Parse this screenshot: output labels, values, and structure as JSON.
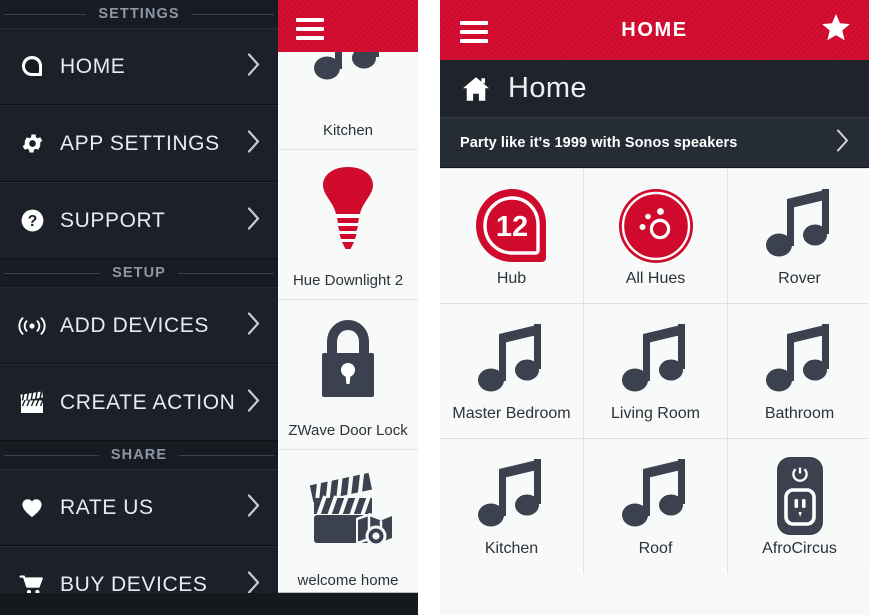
{
  "colors": {
    "brand_red": "#CF0A2C",
    "sidebar_bg": "#181B21",
    "nav_row_bg": "#1C2028",
    "dark_bar": "#1E232C",
    "promo_bg": "#262C35",
    "tile_bg": "#F8F9F9",
    "icon_dark": "#3B414E",
    "section_label": "#8D97A8"
  },
  "left_screen": {
    "sidebar": {
      "sections": [
        {
          "label": "SETTINGS",
          "items": [
            {
              "label": "HOME",
              "icon": "home-rounded-icon",
              "chevron": "›"
            },
            {
              "label": "APP SETTINGS",
              "icon": "gear-icon",
              "chevron": "›"
            },
            {
              "label": "SUPPORT",
              "icon": "question-circle-icon",
              "chevron": "›"
            }
          ]
        },
        {
          "label": "SETUP",
          "items": [
            {
              "label": "ADD DEVICES",
              "icon": "broadcast-icon",
              "chevron": "›"
            },
            {
              "label": "CREATE ACTION",
              "icon": "clapperboard-icon",
              "chevron": "›"
            }
          ]
        },
        {
          "label": "SHARE",
          "items": [
            {
              "label": "RATE US",
              "icon": "heart-icon",
              "chevron": "›"
            },
            {
              "label": "BUY DEVICES",
              "icon": "shopping-cart-icon",
              "chevron": "›"
            }
          ]
        }
      ]
    },
    "device_strip": {
      "menu_icon": "hamburger-menu-icon",
      "cells": [
        {
          "label": "Kitchen",
          "icon": "music-note-icon",
          "icon_color": "#3B414E"
        },
        {
          "label": "Hue Downlight 2",
          "icon": "light-bulb-icon",
          "icon_color": "#CF0A2C"
        },
        {
          "label": "ZWave Door Lock",
          "icon": "padlock-icon",
          "icon_color": "#3B414E"
        },
        {
          "label": "welcome home",
          "icon": "clapperboard-map-icon",
          "icon_color": "#3B414E"
        }
      ]
    }
  },
  "right_screen": {
    "app_bar": {
      "menu_icon": "hamburger-menu-icon",
      "title": "HOME",
      "favorite_icon": "star-icon"
    },
    "location_bar": {
      "icon": "house-icon",
      "name": "Home"
    },
    "promo": {
      "text": "Party like it's 1999 with Sonos speakers",
      "chevron": "›"
    },
    "tiles": [
      {
        "label": "Hub",
        "icon": "smartthings-hub-icon",
        "badge": "12",
        "icon_color": "#CF0A2C"
      },
      {
        "label": "All Hues",
        "icon": "hue-group-icon",
        "icon_color": "#CF0A2C"
      },
      {
        "label": "Rover",
        "icon": "music-note-icon",
        "icon_color": "#3B414E"
      },
      {
        "label": "Master Bedroom",
        "icon": "music-note-icon",
        "icon_color": "#3B414E"
      },
      {
        "label": "Living Room",
        "icon": "music-note-icon",
        "icon_color": "#3B414E"
      },
      {
        "label": "Bathroom",
        "icon": "music-note-icon",
        "icon_color": "#3B414E"
      },
      {
        "label": "Kitchen",
        "icon": "music-note-icon",
        "icon_color": "#3B414E"
      },
      {
        "label": "Roof",
        "icon": "music-note-icon",
        "icon_color": "#3B414E"
      },
      {
        "label": "AfroCircus",
        "icon": "smart-plug-icon",
        "icon_color": "#3B414E"
      }
    ]
  }
}
